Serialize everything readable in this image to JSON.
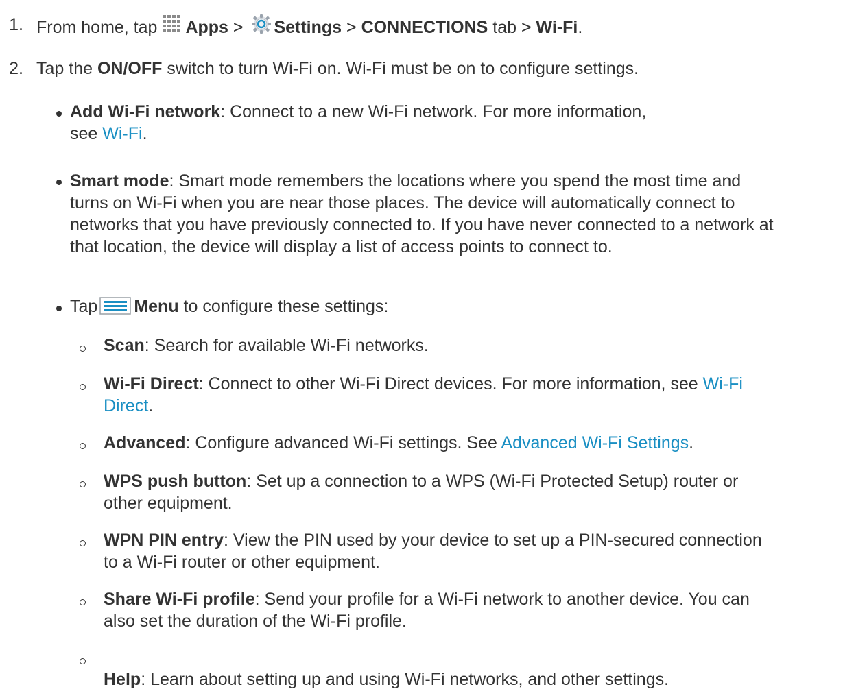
{
  "steps": [
    {
      "number": "1.",
      "parts": {
        "from_home_tap": "From home, tap",
        "apps": "Apps",
        "gt1": " > ",
        "settings": "Settings",
        "gt2": " > ",
        "connections": "CONNECTIONS",
        "tab_gt": " tab > ",
        "wifi": "Wi-Fi",
        "period": "."
      },
      "icons": {
        "apps": "apps-grid-icon",
        "settings": "settings-gear-icon"
      }
    },
    {
      "number": "2.",
      "parts": {
        "tap_the": "Tap the ",
        "onoff": "ON/OFF",
        "rest": " switch to turn Wi-Fi on. Wi-Fi must be on to configure settings."
      }
    }
  ],
  "bullets": {
    "add": {
      "term": "Add Wi-Fi network",
      "desc": ": Connect to a new Wi-Fi network. For more information,",
      "see": "see ",
      "link": "Wi-Fi",
      "end": "."
    },
    "smart": {
      "term": "Smart mode",
      "lines": [
        ": Smart mode remembers the locations where you spend the most time and",
        "turns on Wi-Fi when you are near those places. The device will automatically connect to",
        "networks that you have previously connected to. If you have never connected to a network at",
        "that location, the device will display a list of access points to connect to."
      ]
    },
    "menu": {
      "tap": "Tap",
      "label": "Menu",
      "rest": " to configure these settings:",
      "icon": "menu-icon"
    }
  },
  "subitems": {
    "scan": {
      "term": "Scan",
      "desc": ": Search for available Wi-Fi networks."
    },
    "direct": {
      "term": "Wi-Fi Direct",
      "desc": ": Connect to other Wi-Fi Direct devices. For more information, see ",
      "link1": "Wi-Fi",
      "link2": "Direct",
      "end": "."
    },
    "advanced": {
      "term": "Advanced",
      "desc": ": Configure advanced Wi-Fi settings. See ",
      "link": "Advanced Wi-Fi Settings",
      "end": "."
    },
    "wps": {
      "term": "WPS push button",
      "desc": ": Set up a connection to a WPS (Wi-Fi Protected Setup) router or",
      "line2": "other equipment."
    },
    "wpn": {
      "term": "WPN PIN entry",
      "desc": ": View the PIN used by your device to set up a PIN-secured connection",
      "line2": "to a Wi-Fi router or other equipment."
    },
    "share": {
      "term": "Share Wi-Fi profile",
      "desc": ": Send your profile for a Wi-Fi network to another device. You can",
      "line2": "also set the duration of the Wi-Fi profile."
    },
    "help": {
      "term": "Help",
      "desc": ": Learn about setting up and using Wi-Fi networks, and other settings."
    }
  },
  "colors": {
    "text": "#333333",
    "link": "#1a8fc3",
    "background": "#ffffff"
  }
}
